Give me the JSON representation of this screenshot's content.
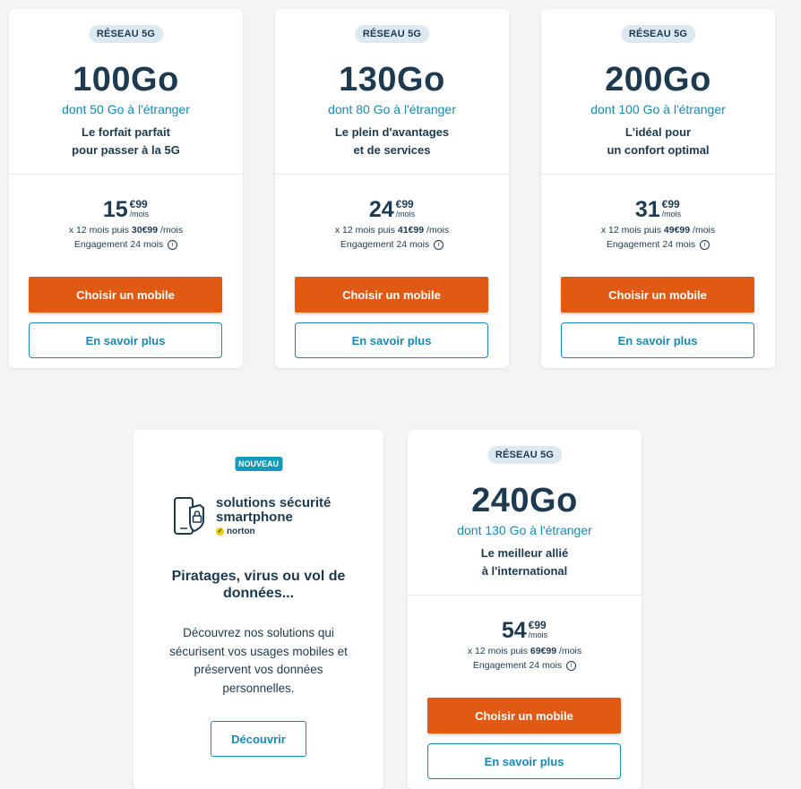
{
  "plans": [
    {
      "badge": "RÉSEAU 5G",
      "data": "100Go",
      "abroad": "dont 50 Go à l'étranger",
      "tagline_1": "Le forfait parfait",
      "tagline_2": "pour passer à la 5G",
      "price_euros": "15",
      "price_cents": "€99",
      "per_month": "/mois",
      "after_prefix": "x 12 mois puis",
      "after_price": "30€99",
      "after_suffix": "/mois",
      "engagement": "Engagement 24 mois",
      "choose_label": "Choisir un mobile",
      "more_label": "En savoir plus"
    },
    {
      "badge": "RÉSEAU 5G",
      "data": "130Go",
      "abroad": "dont 80 Go à l'étranger",
      "tagline_1": "Le plein d'avantages",
      "tagline_2": "et de services",
      "price_euros": "24",
      "price_cents": "€99",
      "per_month": "/mois",
      "after_prefix": "x 12 mois puis",
      "after_price": "41€99",
      "after_suffix": "/mois",
      "engagement": "Engagement 24 mois",
      "choose_label": "Choisir un mobile",
      "more_label": "En savoir plus"
    },
    {
      "badge": "RÉSEAU 5G",
      "data": "200Go",
      "abroad": "dont 100 Go à l'étranger",
      "tagline_1": "L'idéal pour",
      "tagline_2": "un confort optimal",
      "price_euros": "31",
      "price_cents": "€99",
      "per_month": "/mois",
      "after_prefix": "x 12 mois puis",
      "after_price": "49€99",
      "after_suffix": "/mois",
      "engagement": "Engagement 24 mois",
      "choose_label": "Choisir un mobile",
      "more_label": "En savoir plus"
    },
    {
      "badge": "RÉSEAU 5G",
      "data": "240Go",
      "abroad": "dont 130 Go à l'étranger",
      "tagline_1": "Le meilleur allié",
      "tagline_2": "à l'international",
      "price_euros": "54",
      "price_cents": "€99",
      "per_month": "/mois",
      "after_prefix": "x 12 mois puis",
      "after_price": "69€99",
      "after_suffix": "/mois",
      "engagement": "Engagement 24 mois",
      "choose_label": "Choisir un mobile",
      "more_label": "En savoir plus"
    }
  ],
  "promo": {
    "badge": "NOUVEAU",
    "logo_line_1": "solutions sécurité",
    "logo_line_2": "smartphone",
    "logo_brand": "norton",
    "title": "Piratages, virus ou vol de données...",
    "text": "Découvrez nos solutions qui sécurisent vos usages mobiles et préservent vos données personnelles.",
    "button_label": "Découvrir"
  },
  "info_icon_glyph": "i",
  "norton_check_glyph": "✓",
  "colors": {
    "accent": "#e05a13",
    "link": "#1a88b6",
    "text": "#1d3a50",
    "badge_bg": "#dce9f1",
    "new_badge": "#1599b9"
  }
}
